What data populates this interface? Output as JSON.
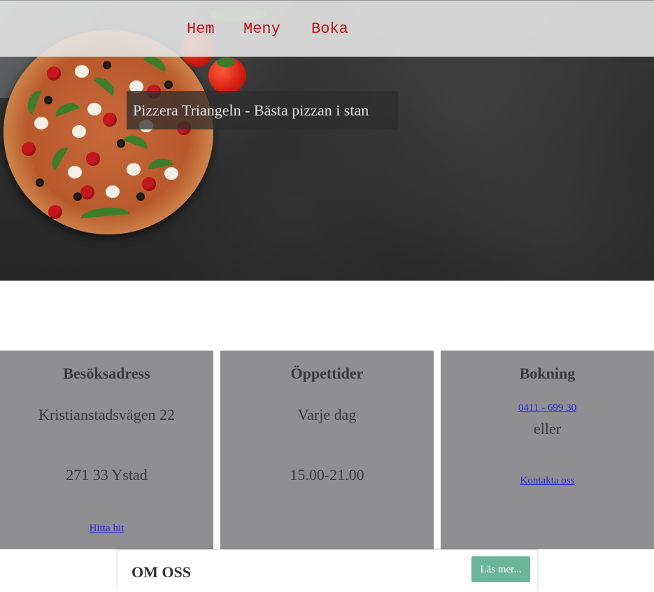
{
  "nav": {
    "items": [
      {
        "label": "Hem"
      },
      {
        "label": "Meny"
      },
      {
        "label": "Boka"
      }
    ],
    "link_color": "#c0151b"
  },
  "hero": {
    "title": "Pizzera Triangeln - Bästa pizzan i stan"
  },
  "info": [
    {
      "heading": "Besöksadress",
      "line1": "Kristianstadsvägen 22",
      "line2": "271 33 Ystad",
      "link": "Hitta hit"
    },
    {
      "heading": "Öppettider",
      "line1": "Varje dag",
      "line2": "15.00-21.00"
    },
    {
      "heading": "Bokning",
      "phone": "0411 - 699 30",
      "line1": "eller",
      "link": "Kontakta oss"
    }
  ],
  "about": {
    "heading": "OM OSS",
    "button": "Läs mer..."
  },
  "colors": {
    "info_bg": "#8f8e90",
    "button_bg": "#6db59a",
    "link": "#2929e0"
  }
}
